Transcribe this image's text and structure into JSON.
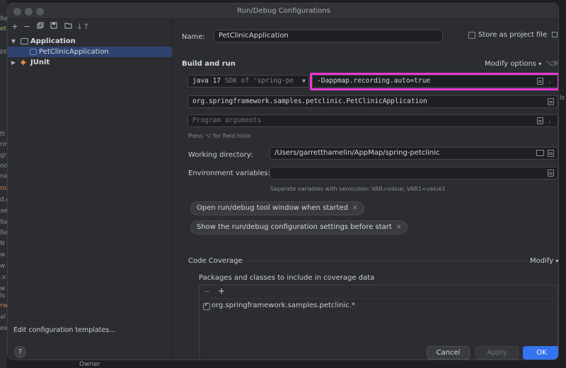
{
  "window": {
    "title": "Run/Debug Configurations"
  },
  "sidebar": {
    "tree": [
      {
        "label": "Application",
        "expanded": true
      },
      {
        "label": "PetClinicApplication",
        "selected": true
      },
      {
        "label": "JUnit",
        "expanded": false
      }
    ],
    "edit_templates": "Edit configuration templates..."
  },
  "form": {
    "name_label": "Name:",
    "name_value": "PetClinicApplication",
    "store_label": "Store as project file",
    "build_run_title": "Build and run",
    "modify_options": "Modify options",
    "modify_shortcut": "⌥M",
    "jdk_value": "java 17",
    "jdk_detail": "SDK of 'spring-pe",
    "vm_options": "-Dappmap.recording.auto=true",
    "main_class": "org.springframework.samples.petclinic.PetClinicApplication",
    "program_args_placeholder": "Program arguments",
    "field_hints": "Press ⌥ for field hints",
    "working_dir_label": "Working directory:",
    "working_dir_value": "/Users/garretthamelin/AppMap/spring-petclinic",
    "env_label": "Environment variables:",
    "env_hint": "Separate variables with semicolon: VAR=value; VAR1=value1",
    "chip_1": "Open run/debug tool window when started",
    "chip_2": "Show the run/debug configuration settings before start",
    "coverage_title": "Code Coverage",
    "coverage_modify": "Modify",
    "coverage_packages_title": "Packages and classes to include in coverage data",
    "coverage_item": "org.springframework.samples.petclinic.*"
  },
  "buttons": {
    "cancel": "Cancel",
    "apply": "Apply",
    "ok": "OK",
    "help": "?"
  },
  "background": {
    "left_fragments": [
      "lle",
      "et",
      "pp",
      "tt",
      "rin",
      "gr",
      "oo",
      "ne",
      "mi",
      "d.g",
      "xe",
      "lle",
      "lle",
      "N",
      "w",
      "w",
      ".x",
      "w",
      "ls",
      "rw",
      "al",
      "ee"
    ],
    "right_fragments": [
      "ls"
    ],
    "bottom_text": "Owner"
  },
  "colors": {
    "accent": "#3574f0",
    "link": "#5b9bf0",
    "highlight": "#ec37d6",
    "selection": "#2e436e"
  }
}
